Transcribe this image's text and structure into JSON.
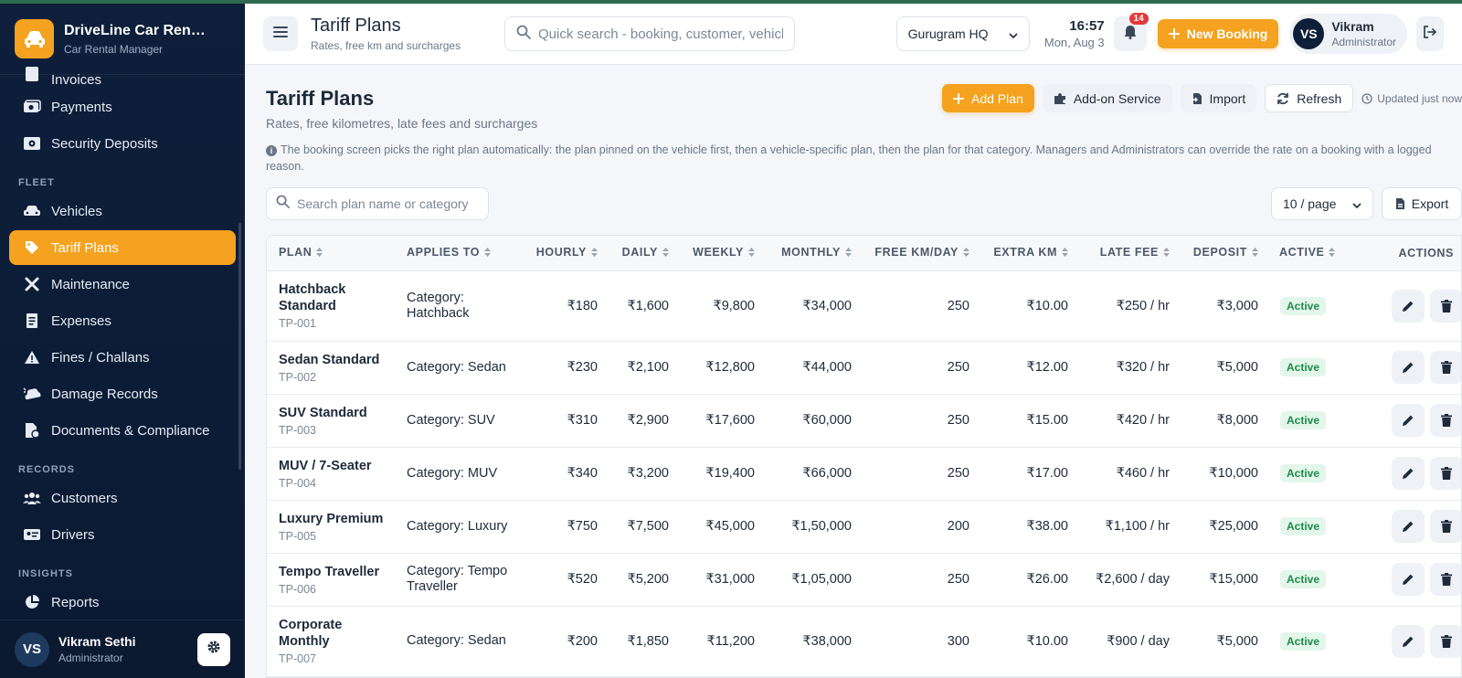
{
  "app": {
    "name": "DriveLine Car Rentals",
    "subtitle": "Car Rental Manager"
  },
  "sidebar": {
    "partial_top_item": "Invoices",
    "items_top": [
      {
        "label": "Payments",
        "icon": "payments-icon"
      },
      {
        "label": "Security Deposits",
        "icon": "deposit-icon"
      }
    ],
    "sections": [
      {
        "title": "FLEET",
        "items": [
          {
            "label": "Vehicles",
            "icon": "car-icon",
            "active": false
          },
          {
            "label": "Tariff Plans",
            "icon": "tag-icon",
            "active": true
          },
          {
            "label": "Maintenance",
            "icon": "wrench-icon",
            "active": false
          },
          {
            "label": "Expenses",
            "icon": "receipt-icon",
            "active": false
          },
          {
            "label": "Fines / Challans",
            "icon": "warning-icon",
            "active": false
          },
          {
            "label": "Damage Records",
            "icon": "car-crash-icon",
            "active": false
          },
          {
            "label": "Documents & Compliance",
            "icon": "document-icon",
            "active": false
          }
        ]
      },
      {
        "title": "RECORDS",
        "items": [
          {
            "label": "Customers",
            "icon": "users-icon",
            "active": false
          },
          {
            "label": "Drivers",
            "icon": "id-card-icon",
            "active": false
          }
        ]
      },
      {
        "title": "INSIGHTS",
        "items": [
          {
            "label": "Reports",
            "icon": "pie-chart-icon",
            "active": false
          }
        ]
      }
    ],
    "user": {
      "initials": "VS",
      "name": "Vikram Sethi",
      "role": "Administrator"
    }
  },
  "header": {
    "title": "Tariff Plans",
    "subtitle": "Rates, free km and surcharges",
    "search_placeholder": "Quick search - booking, customer, vehicle",
    "branch": "Gurugram HQ",
    "time": "16:57",
    "date": "Mon, Aug 3",
    "notification_count": "14",
    "new_booking_label": "New Booking",
    "user": {
      "initials": "VS",
      "name": "Vikram",
      "role": "Administrator"
    }
  },
  "page": {
    "title": "Tariff Plans",
    "subtitle": "Rates, free kilometres, late fees and surcharges",
    "actions": {
      "add_plan": "Add Plan",
      "addon_service": "Add-on Service",
      "import": "Import",
      "refresh": "Refresh",
      "updated": "Updated just now"
    },
    "info_note": "The booking screen picks the right plan automatically: the plan pinned on the vehicle first, then a vehicle-specific plan, then the plan for that category. Managers and Administrators can override the rate on a booking with a logged reason.",
    "plan_search_placeholder": "Search plan name or category",
    "page_size": "10 / page",
    "export_label": "Export"
  },
  "table": {
    "columns": [
      "PLAN",
      "APPLIES TO",
      "HOURLY",
      "DAILY",
      "WEEKLY",
      "MONTHLY",
      "FREE KM/DAY",
      "EXTRA KM",
      "LATE FEE",
      "DEPOSIT",
      "ACTIVE",
      "ACTIONS"
    ],
    "rows": [
      {
        "name": "Hatchback Standard",
        "code": "TP-001",
        "applies": "Category: Hatchback",
        "hourly": "₹180",
        "daily": "₹1,600",
        "weekly": "₹9,800",
        "monthly": "₹34,000",
        "free_km": "250",
        "extra_km": "₹10.00",
        "late_fee": "₹250 / hr",
        "deposit": "₹3,000",
        "status": "Active"
      },
      {
        "name": "Sedan Standard",
        "code": "TP-002",
        "applies": "Category: Sedan",
        "hourly": "₹230",
        "daily": "₹2,100",
        "weekly": "₹12,800",
        "monthly": "₹44,000",
        "free_km": "250",
        "extra_km": "₹12.00",
        "late_fee": "₹320 / hr",
        "deposit": "₹5,000",
        "status": "Active"
      },
      {
        "name": "SUV Standard",
        "code": "TP-003",
        "applies": "Category: SUV",
        "hourly": "₹310",
        "daily": "₹2,900",
        "weekly": "₹17,600",
        "monthly": "₹60,000",
        "free_km": "250",
        "extra_km": "₹15.00",
        "late_fee": "₹420 / hr",
        "deposit": "₹8,000",
        "status": "Active"
      },
      {
        "name": "MUV / 7-Seater",
        "code": "TP-004",
        "applies": "Category: MUV",
        "hourly": "₹340",
        "daily": "₹3,200",
        "weekly": "₹19,400",
        "monthly": "₹66,000",
        "free_km": "250",
        "extra_km": "₹17.00",
        "late_fee": "₹460 / hr",
        "deposit": "₹10,000",
        "status": "Active"
      },
      {
        "name": "Luxury Premium",
        "code": "TP-005",
        "applies": "Category: Luxury",
        "hourly": "₹750",
        "daily": "₹7,500",
        "weekly": "₹45,000",
        "monthly": "₹1,50,000",
        "free_km": "200",
        "extra_km": "₹38.00",
        "late_fee": "₹1,100 / hr",
        "deposit": "₹25,000",
        "status": "Active"
      },
      {
        "name": "Tempo Traveller",
        "code": "TP-006",
        "applies": "Category: Tempo Traveller",
        "hourly": "₹520",
        "daily": "₹5,200",
        "weekly": "₹31,000",
        "monthly": "₹1,05,000",
        "free_km": "250",
        "extra_km": "₹26.00",
        "late_fee": "₹2,600 / day",
        "deposit": "₹15,000",
        "status": "Active"
      },
      {
        "name": "Corporate Monthly",
        "code": "TP-007",
        "applies": "Category: Sedan",
        "hourly": "₹200",
        "daily": "₹1,850",
        "weekly": "₹11,200",
        "monthly": "₹38,000",
        "free_km": "300",
        "extra_km": "₹10.00",
        "late_fee": "₹900 / day",
        "deposit": "₹5,000",
        "status": "Active"
      }
    ]
  },
  "colors": {
    "accent": "#f4a21f",
    "sidebar": "#0d1f3a",
    "active_green": "#1f8a4c"
  }
}
